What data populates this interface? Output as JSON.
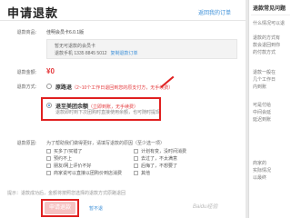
{
  "page": {
    "title": "申请退款",
    "prev_link": "返回我的订单"
  },
  "form": {
    "product_label": "退款商品:",
    "product_value": "佳明会员卡6.0.1版",
    "notice_line1": "暂无可退款的会员卡",
    "notice_line2": "退款手机 1335 8845 5012",
    "notice_copy": "复制退款订单",
    "amount_label": "退款金额:",
    "amount_value": "¥0",
    "method_label": "退款方式:",
    "reason_label": "退款原因:"
  },
  "methods": [
    {
      "name": "原路退",
      "tag": "（2~10个工作日退回到您的原支付方，无手续费）",
      "desc": "",
      "selected": false
    },
    {
      "name": "退至美团余额",
      "tag": "（立即到账，无手续费）",
      "desc": "退款即时到下次团购时直接使用余额，也可随时提现",
      "selected": true
    }
  ],
  "reasons": {
    "heading": "为了帮助我们做得更好，请填写退款的原因（至少选一项）",
    "items": [
      "买多了/买错了",
      "计划有变，没时间消费",
      "预约不上",
      "去过了，不太满意",
      "朋友/网上评价不好",
      "后悔了，不想要了",
      "商家说可以直接以团购价到店消费",
      "其他"
    ]
  },
  "footer": {
    "note": "提示：退款成功后，金额将按照您选择的退款方式原路退回",
    "submit": "申请退款",
    "not_now": "暂不退"
  },
  "sidebar": {
    "heading": "退款常见问题",
    "lines": [
      "什么情况可以退",
      "退款的方式有",
      "款会退回到你",
      "的付款方式",
      "退款一般在",
      "几个工作日",
      "内到账",
      "可是付给",
      "中间会延",
      "延迟到账",
      "商家的",
      "实际情况",
      "以最终"
    ]
  },
  "watermark": "Baidu经验"
}
